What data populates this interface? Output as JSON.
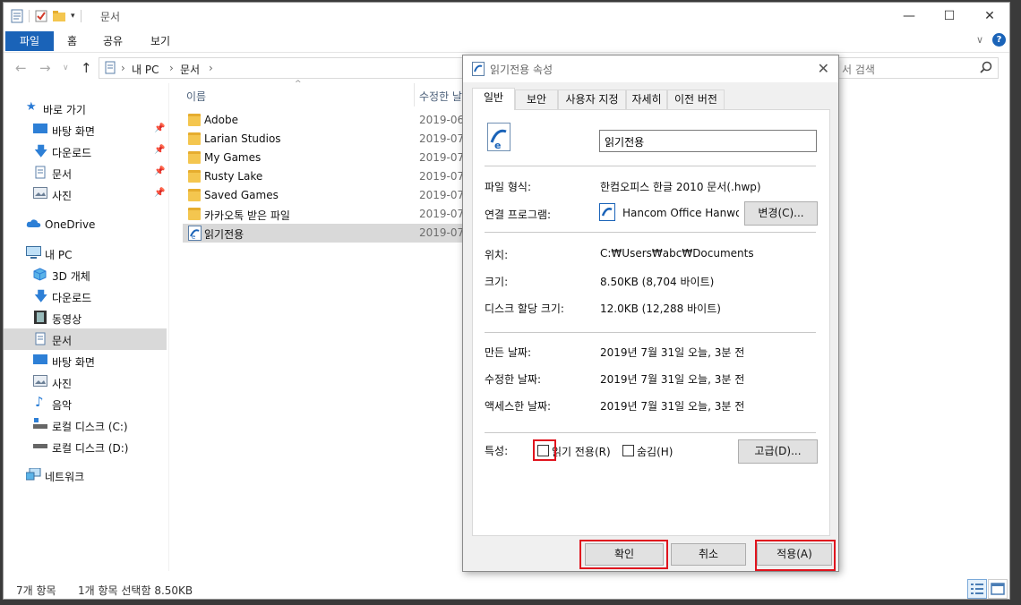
{
  "explorer": {
    "title": "문서",
    "ribbon_tabs": [
      "파일",
      "홈",
      "공유",
      "보기"
    ],
    "breadcrumb": [
      "내 PC",
      "문서"
    ],
    "search_placeholder": "서 검색",
    "nav": {
      "quick_access": "바로 가기",
      "quick_items": [
        "바탕 화면",
        "다운로드",
        "문서",
        "사진"
      ],
      "onedrive": "OneDrive",
      "this_pc": "내 PC",
      "pc_items": [
        "3D 개체",
        "다운로드",
        "동영상",
        "문서",
        "바탕 화면",
        "사진",
        "음악",
        "로컬 디스크 (C:)",
        "로컬 디스크 (D:)"
      ],
      "network": "네트워크"
    },
    "columns": {
      "name": "이름",
      "modified": "수정한 날"
    },
    "files": [
      {
        "name": "Adobe",
        "date": "2019-06-"
      },
      {
        "name": "Larian Studios",
        "date": "2019-07-"
      },
      {
        "name": "My Games",
        "date": "2019-07-"
      },
      {
        "name": "Rusty Lake",
        "date": "2019-07-"
      },
      {
        "name": "Saved Games",
        "date": "2019-07-"
      },
      {
        "name": "카카오톡 받은 파일",
        "date": "2019-07-"
      },
      {
        "name": "읽기전용",
        "date": "2019-07-"
      }
    ],
    "status": {
      "count": "7개 항목",
      "selected": "1개 항목 선택함 8.50KB"
    }
  },
  "dialog": {
    "title": "읽기전용 속성",
    "tabs": [
      "일반",
      "보안",
      "사용자 지정",
      "자세히",
      "이전 버전"
    ],
    "filename": "읽기전용",
    "file_type_label": "파일 형식:",
    "file_type": "한컴오피스 한글 2010 문서(.hwp)",
    "opens_with_label": "연결 프로그램:",
    "opens_with": "Hancom Office Hanwor",
    "change_button": "변경(C)...",
    "location_label": "위치:",
    "location": "C:₩Users₩abc₩Documents",
    "size_label": "크기:",
    "size": "8.50KB (8,704 바이트)",
    "disk_size_label": "디스크 할당 크기:",
    "disk_size": "12.0KB (12,288 바이트)",
    "created_label": "만든 날짜:",
    "created": "2019년 7월 31일 오늘, 3분 전",
    "modified_label": "수정한 날짜:",
    "modified": "2019년 7월 31일 오늘, 3분 전",
    "accessed_label": "액세스한 날짜:",
    "accessed": "2019년 7월 31일 오늘, 3분 전",
    "attributes_label": "특성:",
    "readonly_label": "읽기 전용(R)",
    "hidden_label": "숨김(H)",
    "advanced_button": "고급(D)...",
    "ok_button": "확인",
    "cancel_button": "취소",
    "apply_button": "적용(A)"
  },
  "colors": {
    "accent": "#1a63b8",
    "highlight": "#e0141e",
    "selection": "#d9d9d9"
  }
}
